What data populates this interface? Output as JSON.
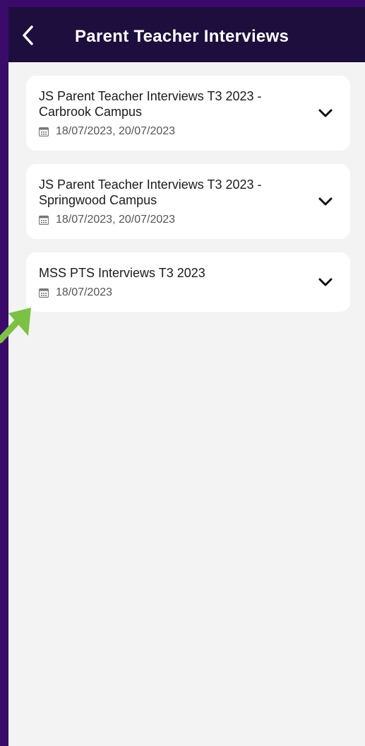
{
  "header": {
    "title": "Parent Teacher Interviews",
    "back_icon": "chevron-left-icon"
  },
  "interviews": [
    {
      "title": "JS Parent Teacher Interviews T3 2023 - Carbrook Campus",
      "dates": "18/07/2023, 20/07/2023"
    },
    {
      "title": "JS Parent Teacher Interviews T3 2023 - Springwood Campus",
      "dates": "18/07/2023, 20/07/2023"
    },
    {
      "title": "MSS PTS Interviews T3 2023",
      "dates": "18/07/2023"
    }
  ],
  "colors": {
    "header_bg": "#1e0e3e",
    "frame": "#3a0b6b",
    "background": "#f3f3f3",
    "card": "#ffffff",
    "annotation_arrow": "#7cc242"
  }
}
